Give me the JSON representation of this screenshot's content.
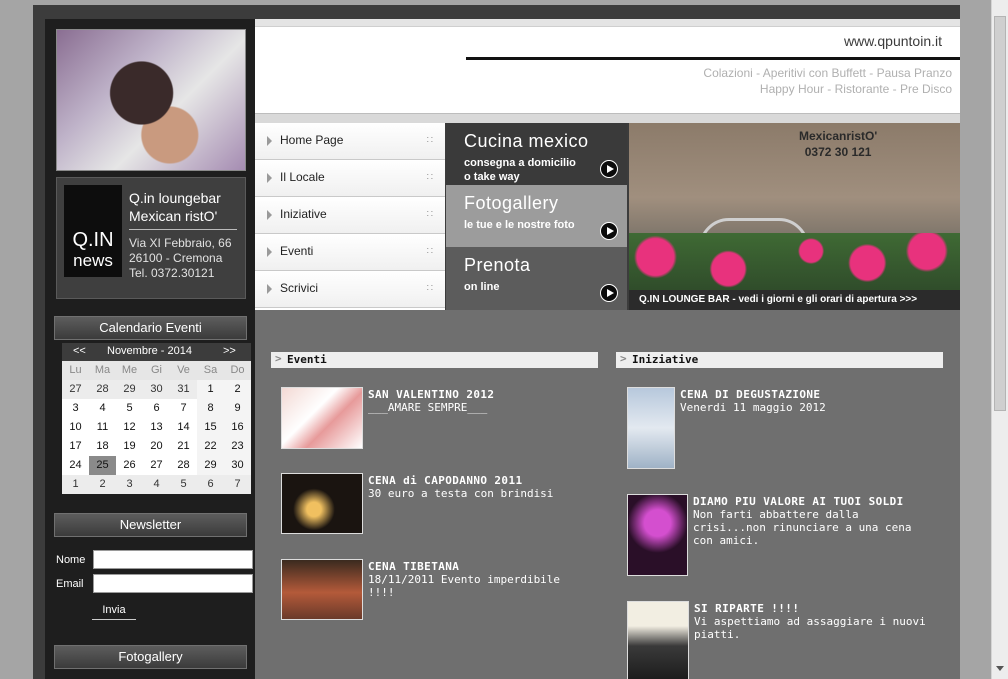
{
  "header": {
    "url": "www.qpuntoin.it",
    "tagline_1": "Colazioni - Aperitivi con Buffett - Pausa Pranzo",
    "tagline_2": "Happy Hour - Ristorante - Pre Disco"
  },
  "brand": {
    "logo_q": "Q.IN",
    "logo_news": "news",
    "name_1": "Q.in loungebar",
    "name_2": "Mexican ristO'",
    "address_1": "Via XI Febbraio, 66",
    "address_2": "26100 - Cremona",
    "address_3": "Tel. 0372.30121"
  },
  "menu": {
    "items": [
      {
        "label": "Home Page"
      },
      {
        "label": "Il Locale"
      },
      {
        "label": "Iniziative"
      },
      {
        "label": "Eventi"
      },
      {
        "label": "Scrivici"
      }
    ],
    "dots": "∷"
  },
  "tiles": {
    "cucina": {
      "title": "Cucina mexico",
      "sub_1": "consegna a domicilio",
      "sub_2": "o take way"
    },
    "fotogallery": {
      "title": "Fotogallery",
      "sub_1": "le tue e le nostre foto"
    },
    "prenota": {
      "title": "Prenota",
      "sub_1": "on line"
    }
  },
  "banner": {
    "sign_1": "MexicanristO'",
    "sign_2": "0372 30 121",
    "caption": "Q.IN LOUNGE BAR   -   vedi i giorni e gli orari di apertura >>>"
  },
  "calendar": {
    "title": "Calendario Eventi",
    "prev": "<<",
    "next": ">>",
    "month": "Novembre - 2014",
    "days_of_week": [
      "Lu",
      "Ma",
      "Me",
      "Gi",
      "Ve",
      "Sa",
      "Do"
    ],
    "weeks": [
      [
        "27",
        "28",
        "29",
        "30",
        "31",
        "1",
        "2"
      ],
      [
        "3",
        "4",
        "5",
        "6",
        "7",
        "8",
        "9"
      ],
      [
        "10",
        "11",
        "12",
        "13",
        "14",
        "15",
        "16"
      ],
      [
        "17",
        "18",
        "19",
        "20",
        "21",
        "22",
        "23"
      ],
      [
        "24",
        "25",
        "26",
        "27",
        "28",
        "29",
        "30"
      ],
      [
        "1",
        "2",
        "3",
        "4",
        "5",
        "6",
        "7"
      ]
    ],
    "today": "25"
  },
  "newsletter": {
    "title": "Newsletter",
    "name_label": "Nome",
    "email_label": "Email",
    "name_value": "",
    "email_value": "",
    "submit": "Invia"
  },
  "fotogallery": {
    "title": "Fotogallery"
  },
  "eventi": {
    "title": "Eventi",
    "posts": [
      {
        "title": "SAN VALENTINO 2012",
        "body": "___AMARE SEMPRE___"
      },
      {
        "title": "CENA di CAPODANNO 2011",
        "body": "30 euro a testa con brindisi"
      },
      {
        "title": "CENA TIBETANA",
        "body": "18/11/2011 Evento imperdibile !!!!"
      }
    ]
  },
  "iniziative": {
    "title": "Iniziative",
    "posts": [
      {
        "title": "CENA DI DEGUSTAZIONE",
        "body": "Venerdi 11 maggio 2012"
      },
      {
        "title": "DIAMO PIU VALORE AI TUOI SOLDI",
        "body": "Non farti abbattere dalla crisi...non rinunciare a una cena con amici."
      },
      {
        "title": "SI RIPARTE !!!!",
        "body": "Vi aspettiamo ad assaggiare i nuovi piatti."
      }
    ]
  }
}
